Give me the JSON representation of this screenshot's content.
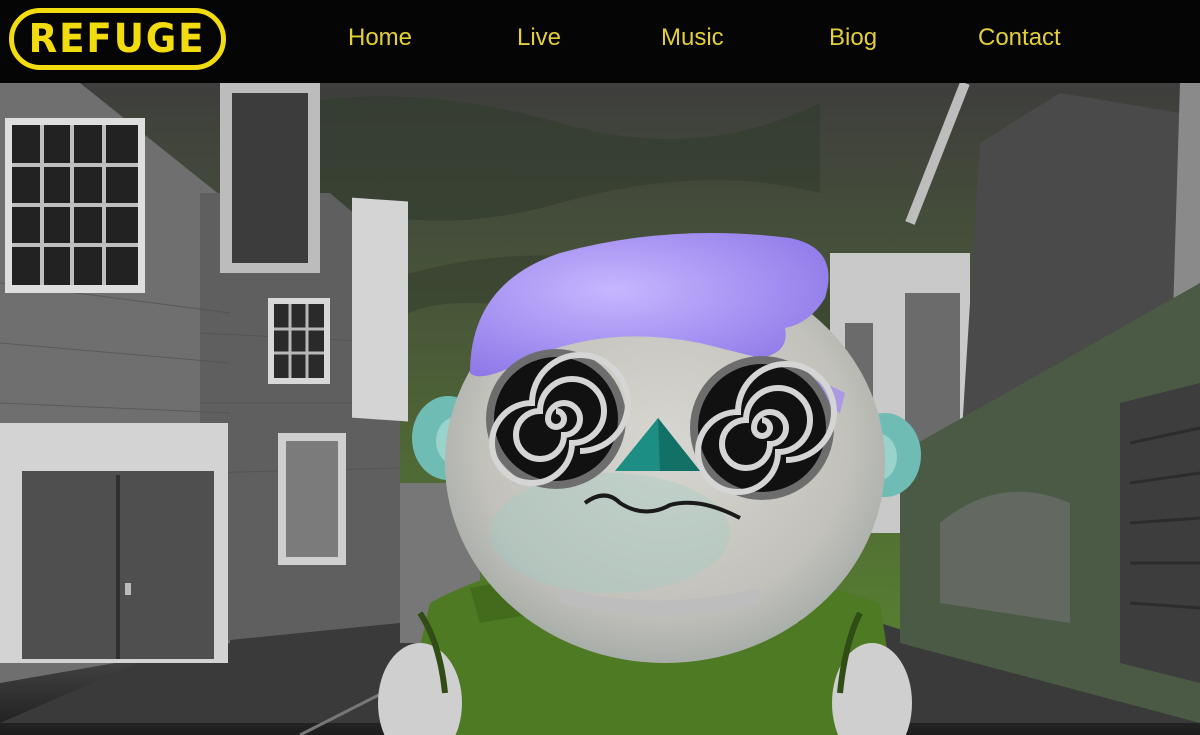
{
  "brand": {
    "logo_text": "REFUGE",
    "accent_color": "#f2dc0e"
  },
  "nav": {
    "items": [
      {
        "label": "Home"
      },
      {
        "label": "Live"
      },
      {
        "label": "Music"
      },
      {
        "label": "Biog"
      },
      {
        "label": "Contact"
      }
    ],
    "text_color": "#e3cf3a",
    "background": "#050505"
  },
  "hero": {
    "image": "animated-character-in-grey-city-street",
    "character_hair_color": "#a58ef0",
    "character_shirt_color": "#4e7a24",
    "sky_color": "#3f5a25"
  }
}
